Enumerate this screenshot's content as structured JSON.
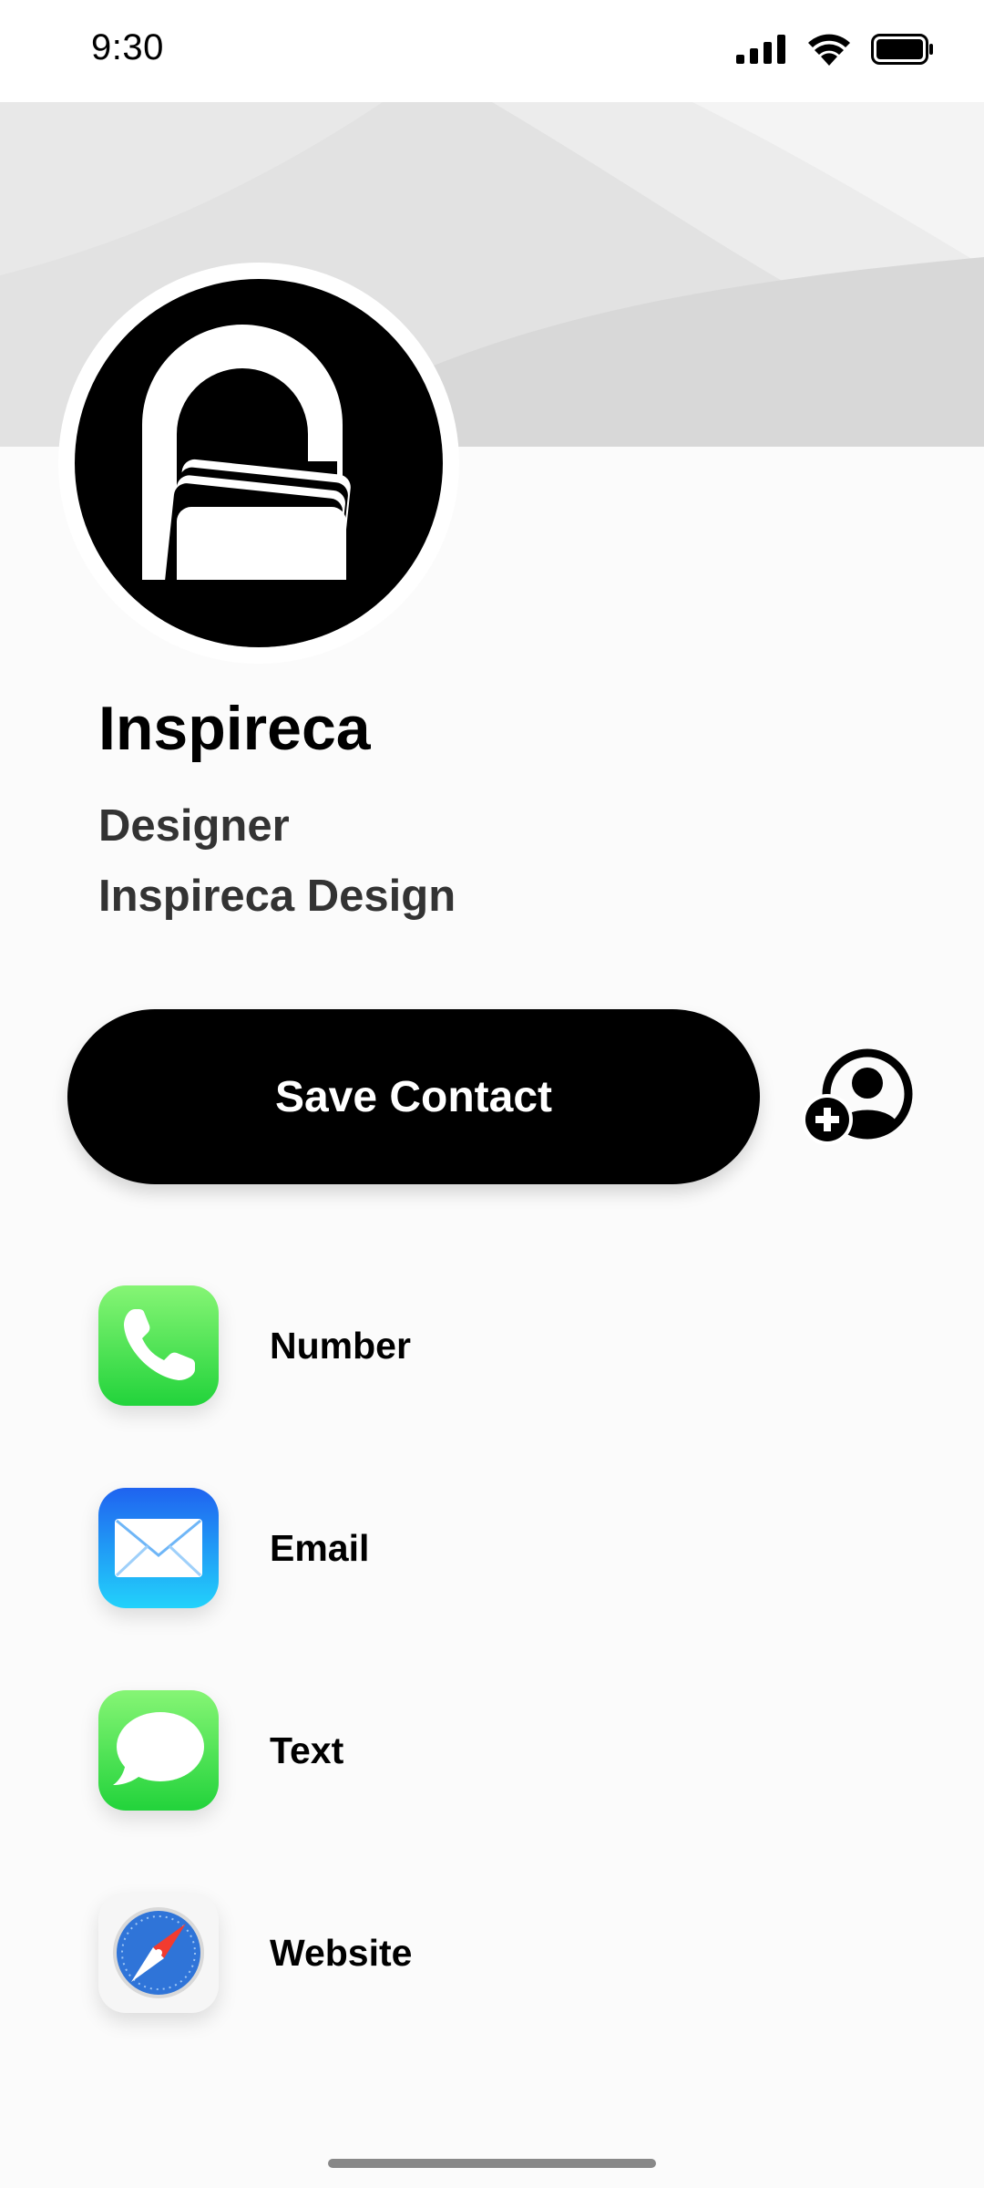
{
  "status_bar": {
    "time": "9:30",
    "icons": [
      "signal-icon",
      "wifi-icon",
      "battery-icon"
    ]
  },
  "profile": {
    "name": "Inspireca",
    "title": "Designer",
    "company": "Inspireca Design"
  },
  "actions": {
    "save_label": "Save Contact",
    "add_contact_icon": "add-contact-icon"
  },
  "contacts": [
    {
      "label": "Number",
      "icon": "phone-icon",
      "color": "#33d74b"
    },
    {
      "label": "Email",
      "icon": "mail-icon",
      "color": "#1f8ef5"
    },
    {
      "label": "Text",
      "icon": "message-icon",
      "color": "#33d74b"
    },
    {
      "label": "Website",
      "icon": "compass-icon",
      "color": "#2f74d8"
    }
  ],
  "colors": {
    "accent": "#000000",
    "background": "#fbfbfb",
    "cover": "#dcdcdc"
  }
}
